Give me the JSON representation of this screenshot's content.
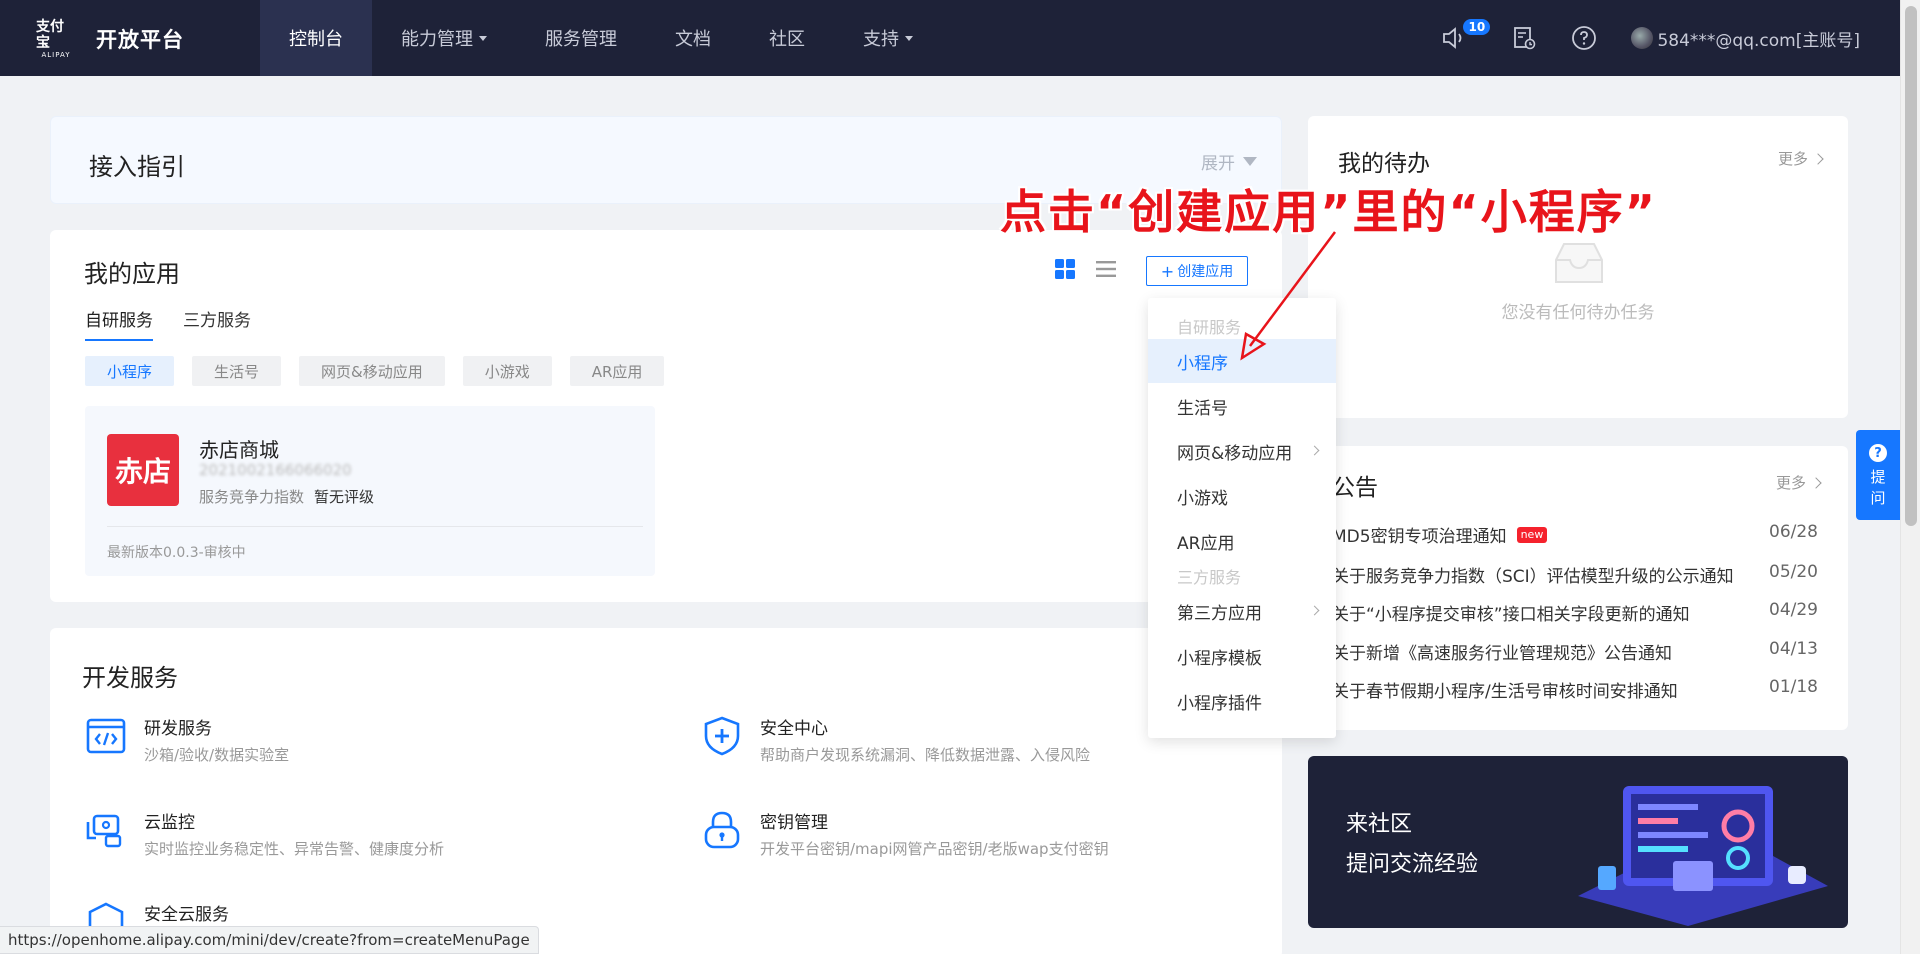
{
  "topbar": {
    "logo_cn": "支付宝",
    "logo_en": "ALIPAY",
    "platform_title": "开放平台",
    "nav": [
      {
        "label": "控制台",
        "active": true
      },
      {
        "label": "能力管理",
        "dropdown": true
      },
      {
        "label": "服务管理"
      },
      {
        "label": "文档"
      },
      {
        "label": "社区"
      },
      {
        "label": "支持",
        "dropdown": true
      }
    ],
    "notification_count": "10",
    "icons": [
      "speaker-icon",
      "document-icon",
      "help-icon"
    ],
    "account": "584***@qq.com[主账号]"
  },
  "guide": {
    "title": "接入指引",
    "expand_label": "展开"
  },
  "apps": {
    "title": "我的应用",
    "create_label": "创建应用",
    "tabs": [
      "自研服务",
      "三方服务"
    ],
    "chips": [
      "小程序",
      "生活号",
      "网页&移动应用",
      "小游戏",
      "AR应用"
    ],
    "app": {
      "logo_text": "赤店",
      "name": "赤店商城",
      "id": "2021002166066020",
      "score_label": "服务竞争力指数",
      "score_value": "暂无评级",
      "version": "最新版本0.0.3-审核中"
    }
  },
  "dropdown": {
    "group1": "自研服务",
    "items1": [
      "小程序",
      "生活号",
      "网页&移动应用",
      "小游戏",
      "AR应用"
    ],
    "group2": "三方服务",
    "items2": [
      "第三方应用",
      "小程序模板",
      "小程序插件"
    ]
  },
  "annotation": "点击“创建应用”里的“小程序”",
  "dev": {
    "title": "开发服务",
    "services": [
      {
        "name": "研发服务",
        "desc": "沙箱/验收/数据实验室",
        "icon": "code-window-icon"
      },
      {
        "name": "安全中心",
        "desc": "帮助商户发现系统漏洞、降低数据泄露、入侵风险",
        "icon": "shield-plus-icon"
      },
      {
        "name": "云监控",
        "desc": "实时监控业务稳定性、异常告警、健康度分析",
        "icon": "monitor-camera-icon"
      },
      {
        "name": "密钥管理",
        "desc": "开发平台密钥/mapi网管产品密钥/老版wap支付密钥",
        "icon": "lock-icon"
      },
      {
        "name": "安全云服务",
        "desc": "",
        "icon": "cloud-shield-icon"
      }
    ]
  },
  "todo": {
    "title": "我的待办",
    "more": "更多",
    "empty": "您没有任何待办任务"
  },
  "notice": {
    "title": "公告",
    "more": "更多",
    "new_tag": "new",
    "rows": [
      {
        "text": "MD5密钥专项治理通知",
        "date": "06/28",
        "new": true
      },
      {
        "text": "关于服务竞争力指数（SCI）评估模型升级的公示通知",
        "date": "05/20"
      },
      {
        "text": "关于“小程序提交审核”接口相关字段更新的通知",
        "date": "04/29"
      },
      {
        "text": "关于新增《高速服务行业管理规范》公告通知",
        "date": "04/13"
      },
      {
        "text": "关于春节假期小程序/生活号审核时间安排通知",
        "date": "01/18"
      }
    ]
  },
  "community": {
    "line1": "来社区",
    "line2": "提问交流经验"
  },
  "float_ask": {
    "q": "?",
    "line1": "提",
    "line2": "问"
  },
  "status_url": "https://openhome.alipay.com/mini/dev/create?from=createMenuPage",
  "colors": {
    "accent": "#1677ff",
    "topbar": "#1e2238",
    "annotation": "#e8141b",
    "brand_red": "#e8303e"
  }
}
